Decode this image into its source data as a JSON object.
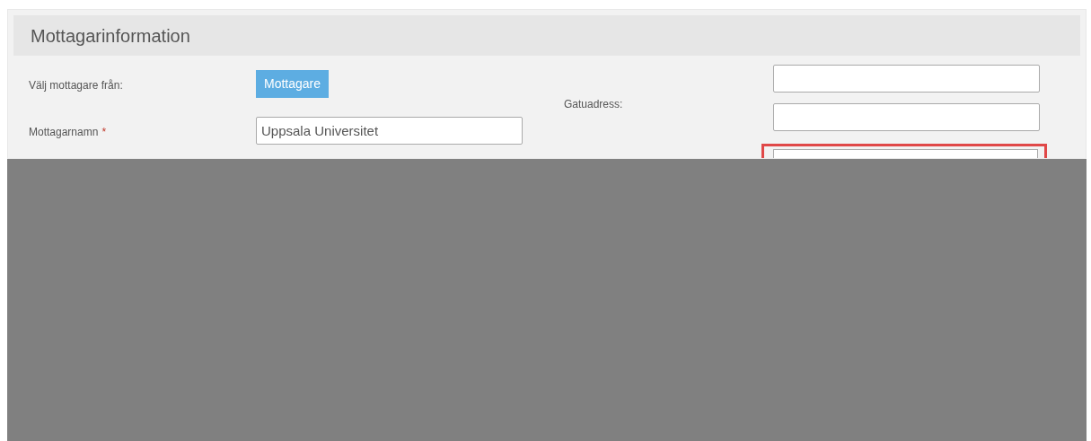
{
  "panel": {
    "title": "Mottagarinformation"
  },
  "left_rows": [
    {
      "kind": "button",
      "label": "Välj mottagare från:",
      "button": "Mottagare"
    },
    {
      "kind": "field",
      "label": "Mottagarnamn",
      "required_mark": "*",
      "value": "Uppsala Universitet"
    }
  ],
  "right": {
    "label": "Gatuadress:",
    "fields": [
      {
        "error": false
      },
      {
        "error": false
      },
      {
        "error": true
      }
    ]
  }
}
